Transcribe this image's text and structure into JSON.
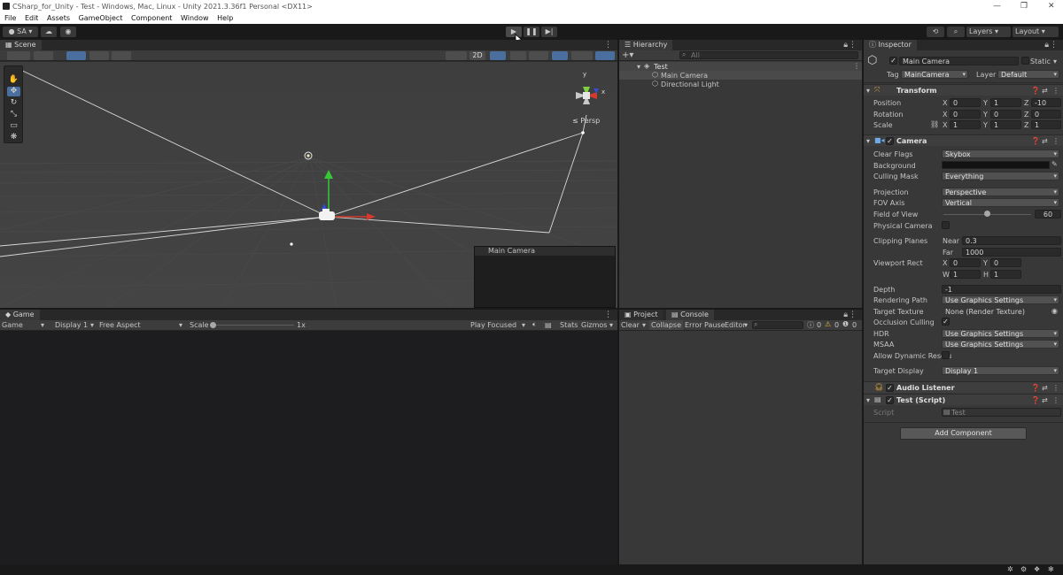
{
  "window": {
    "title": "CSharp_for_Unity - Test - Windows, Mac, Linux - Unity 2021.3.36f1 Personal <DX11>"
  },
  "menu": [
    "File",
    "Edit",
    "Assets",
    "GameObject",
    "Component",
    "Window",
    "Help"
  ],
  "toolbar": {
    "account": "SA ▾",
    "layers": "Layers",
    "layout": "Layout"
  },
  "scene": {
    "tab": "Scene",
    "btn_2d": "2D",
    "persp": "≤ Persp",
    "axis_y": "y",
    "axis_x": "x",
    "preview_title": "Main Camera"
  },
  "game": {
    "tab": "Game",
    "mode": "Game",
    "display": "Display 1",
    "aspect": "Free Aspect",
    "scale_label": "Scale",
    "scale_value": "1x",
    "play_focused": "Play Focused",
    "stats": "Stats",
    "gizmos": "Gizmos"
  },
  "hierarchy": {
    "tab": "Hierarchy",
    "search_placeholder": "All",
    "scene_name": "Test",
    "items": [
      "Main Camera",
      "Directional Light"
    ]
  },
  "console": {
    "tab_project": "Project",
    "tab_console": "Console",
    "clear": "Clear",
    "collapse": "Collapse",
    "error_pause": "Error Pause",
    "editor": "Editor",
    "count_log": "0",
    "count_warn": "0",
    "count_error": "0"
  },
  "inspector": {
    "tab": "Inspector",
    "object_name": "Main Camera",
    "static_label": "Static",
    "tag_label": "Tag",
    "tag_value": "MainCamera",
    "layer_label": "Layer",
    "layer_value": "Default",
    "transform": {
      "title": "Transform",
      "position": {
        "label": "Position",
        "x": "0",
        "y": "1",
        "z": "-10"
      },
      "rotation": {
        "label": "Rotation",
        "x": "0",
        "y": "0",
        "z": "0"
      },
      "scale": {
        "label": "Scale",
        "x": "1",
        "y": "1",
        "z": "1"
      }
    },
    "camera": {
      "title": "Camera",
      "clear_flags": {
        "label": "Clear Flags",
        "value": "Skybox"
      },
      "background": {
        "label": "Background",
        "color": "#121212"
      },
      "culling_mask": {
        "label": "Culling Mask",
        "value": "Everything"
      },
      "projection": {
        "label": "Projection",
        "value": "Perspective"
      },
      "fov_axis": {
        "label": "FOV Axis",
        "value": "Vertical"
      },
      "field_of_view": {
        "label": "Field of View",
        "value": "60",
        "slider_fraction": 0.5
      },
      "physical_camera": {
        "label": "Physical Camera"
      },
      "clipping_planes": {
        "label": "Clipping Planes",
        "near_label": "Near",
        "near": "0.3",
        "far_label": "Far",
        "far": "1000"
      },
      "viewport_rect": {
        "label": "Viewport Rect",
        "x": "0",
        "y": "0",
        "w": "1",
        "h": "1"
      },
      "depth": {
        "label": "Depth",
        "value": "-1"
      },
      "rendering_path": {
        "label": "Rendering Path",
        "value": "Use Graphics Settings"
      },
      "target_texture": {
        "label": "Target Texture",
        "value": "None (Render Texture)"
      },
      "occlusion_culling": {
        "label": "Occlusion Culling"
      },
      "hdr": {
        "label": "HDR",
        "value": "Use Graphics Settings"
      },
      "msaa": {
        "label": "MSAA",
        "value": "Use Graphics Settings"
      },
      "allow_dynamic": {
        "label": "Allow Dynamic Resolu"
      },
      "target_display": {
        "label": "Target Display",
        "value": "Display 1"
      }
    },
    "audio_listener": {
      "title": "Audio Listener"
    },
    "script_component": {
      "title": "Test (Script)",
      "script_label": "Script",
      "script_value": "Test"
    },
    "add_component": "Add Component"
  },
  "axis_letters": {
    "x": "X",
    "y": "Y",
    "z": "Z",
    "w": "W",
    "h": "H"
  }
}
